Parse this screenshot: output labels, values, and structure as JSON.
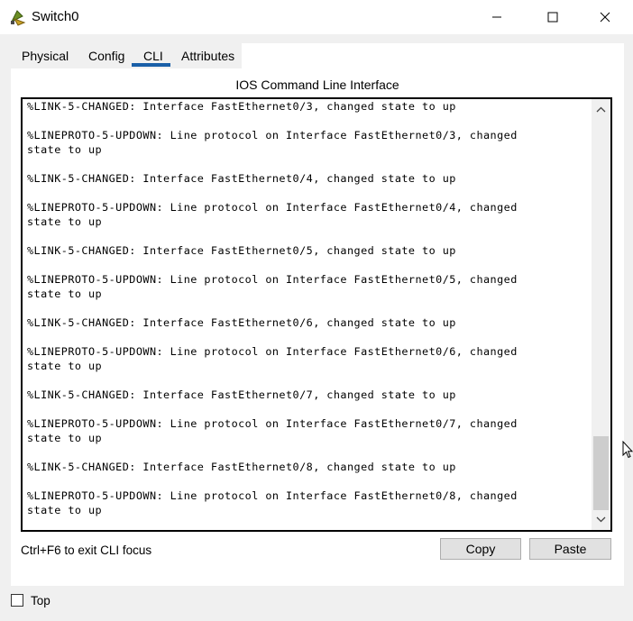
{
  "window": {
    "title": "Switch0",
    "app_icon": "packet-tracer-switch-icon"
  },
  "tabs": [
    {
      "label": "Physical"
    },
    {
      "label": "Config"
    },
    {
      "label": "CLI",
      "active": true
    },
    {
      "label": "Attributes"
    }
  ],
  "cli": {
    "heading": "IOS Command Line Interface",
    "lines": [
      "%LINK-5-CHANGED: Interface FastEthernet0/3, changed state to up",
      "",
      "%LINEPROTO-5-UPDOWN: Line protocol on Interface FastEthernet0/3, changed",
      "state to up",
      "",
      "%LINK-5-CHANGED: Interface FastEthernet0/4, changed state to up",
      "",
      "%LINEPROTO-5-UPDOWN: Line protocol on Interface FastEthernet0/4, changed",
      "state to up",
      "",
      "%LINK-5-CHANGED: Interface FastEthernet0/5, changed state to up",
      "",
      "%LINEPROTO-5-UPDOWN: Line protocol on Interface FastEthernet0/5, changed",
      "state to up",
      "",
      "%LINK-5-CHANGED: Interface FastEthernet0/6, changed state to up",
      "",
      "%LINEPROTO-5-UPDOWN: Line protocol on Interface FastEthernet0/6, changed",
      "state to up",
      "",
      "%LINK-5-CHANGED: Interface FastEthernet0/7, changed state to up",
      "",
      "%LINEPROTO-5-UPDOWN: Line protocol on Interface FastEthernet0/7, changed",
      "state to up",
      "",
      "%LINK-5-CHANGED: Interface FastEthernet0/8, changed state to up",
      "",
      "%LINEPROTO-5-UPDOWN: Line protocol on Interface FastEthernet0/8, changed",
      "state to up"
    ],
    "hint": "Ctrl+F6 to exit CLI focus",
    "copy_label": "Copy",
    "paste_label": "Paste"
  },
  "footer": {
    "top_label": "Top",
    "top_checked": false
  },
  "colors": {
    "tab_accent": "#1a5fa8",
    "panel_bg": "#ffffff",
    "window_bg": "#f0f0f0"
  }
}
